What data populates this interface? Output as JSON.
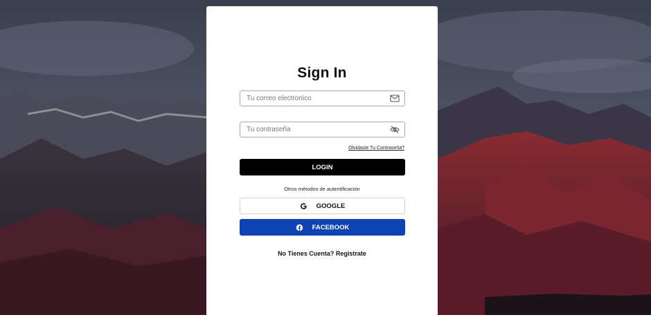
{
  "form": {
    "title": "Sign In",
    "email_placeholder": "Tu correo electronico",
    "password_placeholder": "Tu contraseña",
    "forgot_link": "Olvidaste Tu Contraseña?",
    "login_label": "LOGIN",
    "other_methods": "Otros métodos de autentificación",
    "google_label": "GOOGLE",
    "facebook_label": "FACEBOOK",
    "register_link": "No Tienes Cuenta? Registrate"
  },
  "icons": {
    "email": "envelope-icon",
    "password": "eye-slash-icon",
    "google": "google-icon",
    "facebook": "facebook-icon"
  },
  "colors": {
    "login_button": "#000000",
    "facebook_button": "#0d43b3",
    "card": "#ffffff"
  }
}
